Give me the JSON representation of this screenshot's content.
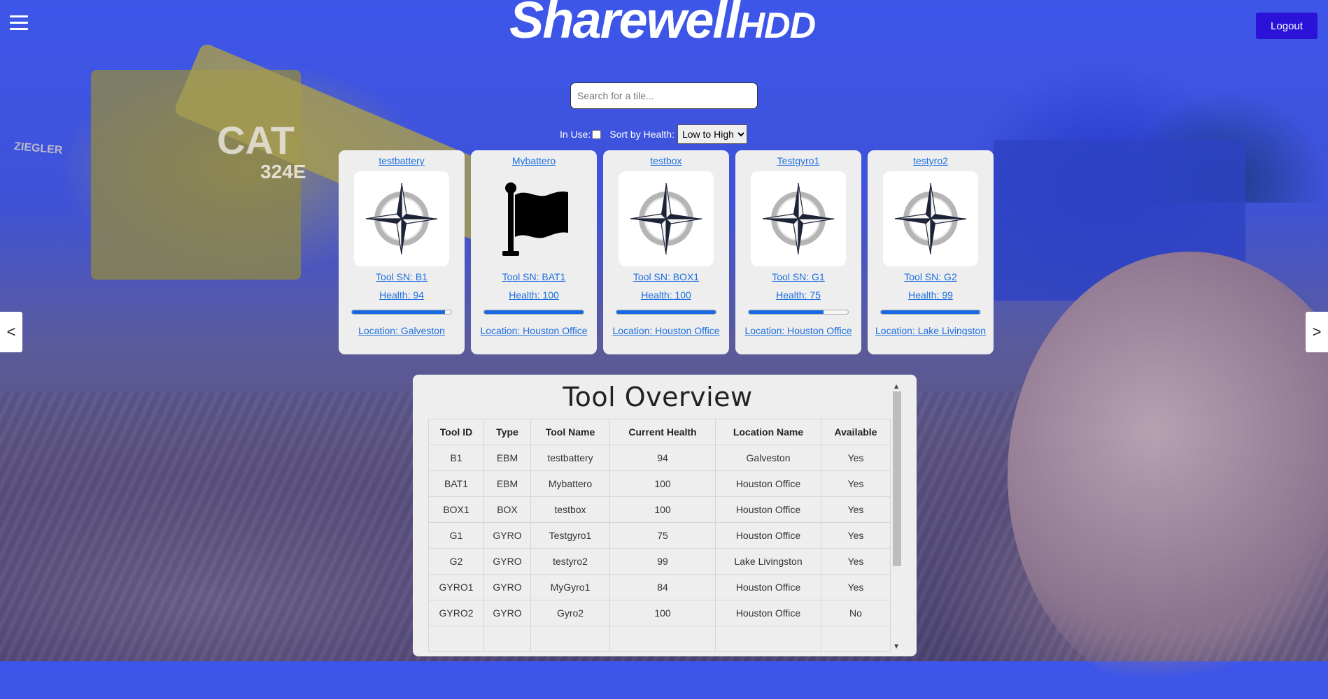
{
  "header": {
    "logo_main": "Sharewell",
    "logo_sub": "HDD",
    "logout_label": "Logout"
  },
  "background": {
    "cat_logo": "CAT",
    "cat_model": "324E",
    "ziegler": "ZIEGLER"
  },
  "search": {
    "placeholder": "Search for a tile..."
  },
  "filters": {
    "in_use_label": "In Use:",
    "in_use_checked": false,
    "sort_label": "Sort by Health:",
    "sort_selected": "Low to High"
  },
  "carousel": {
    "prev_label": "<",
    "next_label": ">"
  },
  "tiles": [
    {
      "name": "testbattery",
      "sn_text": "Tool SN: B1",
      "health_text": "Health: 94",
      "health": 94,
      "location_text": "Location: Galveston",
      "icon": "compass-rose-icon"
    },
    {
      "name": "Mybattero",
      "sn_text": "Tool SN: BAT1",
      "health_text": "Health: 100",
      "health": 100,
      "location_text": "Location: Houston Office",
      "icon": "flag-icon"
    },
    {
      "name": "testbox",
      "sn_text": "Tool SN: BOX1",
      "health_text": "Health: 100",
      "health": 100,
      "location_text": "Location: Houston Office",
      "icon": "compass-rose-icon"
    },
    {
      "name": "Testgyro1",
      "sn_text": "Tool SN: G1",
      "health_text": "Health: 75",
      "health": 75,
      "location_text": "Location: Houston Office",
      "icon": "compass-rose-icon"
    },
    {
      "name": "testyro2",
      "sn_text": "Tool SN: G2",
      "health_text": "Health: 99",
      "health": 99,
      "location_text": "Location: Lake Livingston",
      "icon": "compass-rose-icon"
    }
  ],
  "overview": {
    "title": "Tool Overview",
    "columns": [
      "Tool ID",
      "Type",
      "Tool Name",
      "Current Health",
      "Location Name",
      "Available"
    ],
    "rows": [
      [
        "B1",
        "EBM",
        "testbattery",
        "94",
        "Galveston",
        "Yes"
      ],
      [
        "BAT1",
        "EBM",
        "Mybattero",
        "100",
        "Houston Office",
        "Yes"
      ],
      [
        "BOX1",
        "BOX",
        "testbox",
        "100",
        "Houston Office",
        "Yes"
      ],
      [
        "G1",
        "GYRO",
        "Testgyro1",
        "75",
        "Houston Office",
        "Yes"
      ],
      [
        "G2",
        "GYRO",
        "testyro2",
        "99",
        "Lake Livingston",
        "Yes"
      ],
      [
        "GYRO1",
        "GYRO",
        "MyGyro1",
        "84",
        "Houston Office",
        "Yes"
      ],
      [
        "GYRO2",
        "GYRO",
        "Gyro2",
        "100",
        "Houston Office",
        "No"
      ]
    ]
  },
  "colors": {
    "accent": "#1668e3",
    "logout_bg": "#2a12d9",
    "link": "#1e6fe0",
    "tile_bg": "#eeeeee"
  }
}
